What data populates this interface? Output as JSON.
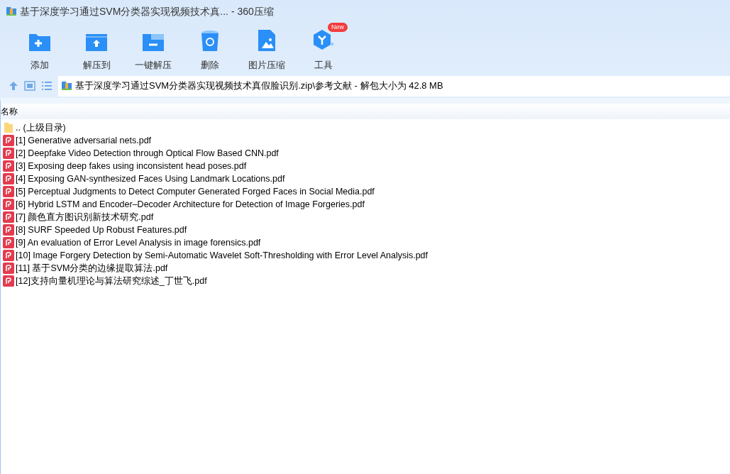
{
  "window": {
    "title": "基于深度学习通过SVM分类器实现视频技术真... - 360压缩"
  },
  "toolbar": [
    {
      "kind": "add",
      "label": "添加"
    },
    {
      "kind": "extract-to",
      "label": "解压到"
    },
    {
      "kind": "one-click",
      "label": "一键解压"
    },
    {
      "kind": "delete",
      "label": "删除"
    },
    {
      "kind": "image",
      "label": "图片压缩"
    },
    {
      "kind": "tools",
      "label": "工具",
      "badge": "New"
    }
  ],
  "address": {
    "path": "基于深度学习通过SVM分类器实现视频技术真假脸识别.zip\\参考文献 - 解包大小为 42.8 MB"
  },
  "file_list": {
    "columns": [
      "名称"
    ],
    "rows": [
      {
        "kind": "folder",
        "name": ".. (上级目录)"
      },
      {
        "kind": "pdf",
        "name": "[1] Generative adversarial nets.pdf"
      },
      {
        "kind": "pdf",
        "name": "[2] Deepfake Video Detection through Optical Flow Based CNN.pdf"
      },
      {
        "kind": "pdf",
        "name": "[3] Exposing deep fakes using inconsistent head poses.pdf"
      },
      {
        "kind": "pdf",
        "name": "[4] Exposing GAN-synthesized Faces Using Landmark Locations.pdf"
      },
      {
        "kind": "pdf",
        "name": "[5] Perceptual Judgments to Detect Computer Generated Forged Faces in Social Media.pdf"
      },
      {
        "kind": "pdf",
        "name": "[6] Hybrid LSTM and Encoder–Decoder Architecture for Detection of Image Forgeries.pdf"
      },
      {
        "kind": "pdf",
        "name": "[7] 颜色直方图识别新技术研究.pdf"
      },
      {
        "kind": "pdf",
        "name": "[8] SURF Speeded Up Robust Features.pdf"
      },
      {
        "kind": "pdf",
        "name": "[9] An evaluation of Error Level Analysis in image forensics.pdf"
      },
      {
        "kind": "pdf",
        "name": "[10] Image Forgery Detection by Semi-Automatic Wavelet Soft-Thresholding with Error Level Analysis.pdf"
      },
      {
        "kind": "pdf",
        "name": "[11] 基于SVM分类的边缘提取算法.pdf"
      },
      {
        "kind": "pdf",
        "name": "[12]支持向量机理论与算法研究综述_丁世飞.pdf"
      }
    ]
  }
}
